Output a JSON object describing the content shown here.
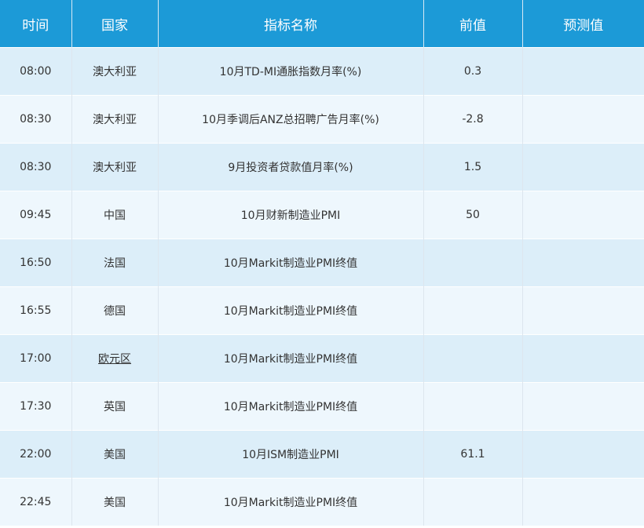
{
  "header": {
    "time": "时间",
    "country": "国家",
    "indicator": "指标名称",
    "previous": "前值",
    "forecast": "预测值"
  },
  "rows": [
    {
      "time": "08:00",
      "country": "澳大利亚",
      "indicator": "10月TD-MI通胀指数月率(%)",
      "previous": "0.3",
      "forecast": ""
    },
    {
      "time": "08:30",
      "country": "澳大利亚",
      "indicator": "10月季调后ANZ总招聘广告月率(%)",
      "previous": "-2.8",
      "forecast": ""
    },
    {
      "time": "08:30",
      "country": "澳大利亚",
      "indicator": "9月投资者贷款值月率(%)",
      "previous": "1.5",
      "forecast": ""
    },
    {
      "time": "09:45",
      "country": "中国",
      "indicator": "10月财新制造业PMI",
      "previous": "50",
      "forecast": ""
    },
    {
      "time": "16:50",
      "country": "法国",
      "indicator": "10月Markit制造业PMI终值",
      "previous": "",
      "forecast": ""
    },
    {
      "time": "16:55",
      "country": "德国",
      "indicator": "10月Markit制造业PMI终值",
      "previous": "",
      "forecast": ""
    },
    {
      "time": "17:00",
      "country": "欧元区",
      "indicator": "10月Markit制造业PMI终值",
      "previous": "",
      "forecast": ""
    },
    {
      "time": "17:30",
      "country": "英国",
      "indicator": "10月Markit制造业PMI终值",
      "previous": "",
      "forecast": ""
    },
    {
      "time": "22:00",
      "country": "美国",
      "indicator": "10月ISM制造业PMI",
      "previous": "61.1",
      "forecast": ""
    },
    {
      "time": "22:45",
      "country": "美国",
      "indicator": "10月Markit制造业PMI终值",
      "previous": "",
      "forecast": ""
    }
  ],
  "colors": {
    "header_bg": "#1c9ad7",
    "row_odd_bg": "#dceef9",
    "row_even_bg": "#eef7fd"
  }
}
